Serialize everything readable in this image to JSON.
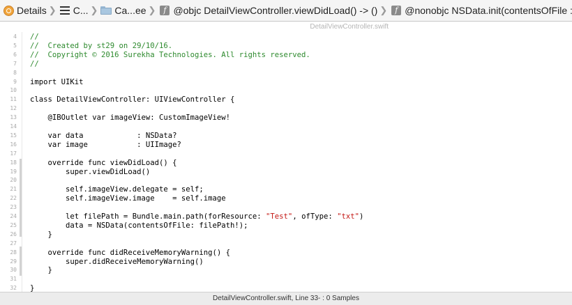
{
  "jumpbar": {
    "crumbs": [
      {
        "label": "Details",
        "icon": "project-icon"
      },
      {
        "label": "C...",
        "icon": "list-icon"
      },
      {
        "label": "Ca...ee",
        "icon": "folder-icon"
      },
      {
        "label": "@objc DetailViewController.viewDidLoad() -> ()",
        "icon": "function-icon"
      },
      {
        "label": "@nonobjc NSData.init(contentsOfFile : String) -> NSData?",
        "icon": "function-icon"
      }
    ]
  },
  "editor": {
    "file_title": "DetailViewController.swift",
    "lines": [
      {
        "n": "4",
        "segments": [
          {
            "t": "//",
            "c": "cm"
          }
        ]
      },
      {
        "n": "5",
        "segments": [
          {
            "t": "//  Created by st29 on 29/10/16.",
            "c": "cm"
          }
        ]
      },
      {
        "n": "6",
        "segments": [
          {
            "t": "//  Copyright © 2016 Surekha Technologies. All rights reserved.",
            "c": "cm"
          }
        ]
      },
      {
        "n": "7",
        "segments": [
          {
            "t": "//",
            "c": "cm"
          }
        ]
      },
      {
        "n": "8",
        "segments": []
      },
      {
        "n": "9",
        "segments": [
          {
            "t": "import UIKit",
            "c": ""
          }
        ]
      },
      {
        "n": "10",
        "segments": []
      },
      {
        "n": "11",
        "segments": [
          {
            "t": "class DetailViewController: UIViewController {",
            "c": ""
          }
        ]
      },
      {
        "n": "12",
        "segments": []
      },
      {
        "n": "13",
        "segments": [
          {
            "t": "    @IBOutlet var imageView: CustomImageView!",
            "c": ""
          }
        ]
      },
      {
        "n": "14",
        "segments": []
      },
      {
        "n": "15",
        "segments": [
          {
            "t": "    var data            : NSData?",
            "c": ""
          }
        ]
      },
      {
        "n": "16",
        "segments": [
          {
            "t": "    var image           : UIImage?",
            "c": ""
          }
        ]
      },
      {
        "n": "17",
        "segments": []
      },
      {
        "n": "18",
        "segments": [
          {
            "t": "    override func viewDidLoad() {",
            "c": ""
          }
        ]
      },
      {
        "n": "19",
        "segments": [
          {
            "t": "        super.viewDidLoad()",
            "c": ""
          }
        ]
      },
      {
        "n": "20",
        "segments": []
      },
      {
        "n": "21",
        "segments": [
          {
            "t": "        self.imageView.delegate = self;",
            "c": ""
          }
        ]
      },
      {
        "n": "22",
        "segments": [
          {
            "t": "        self.imageView.image    = self.image",
            "c": ""
          }
        ]
      },
      {
        "n": "23",
        "segments": []
      },
      {
        "n": "24",
        "segments": [
          {
            "t": "        let filePath = Bundle.main.path(forResource: ",
            "c": ""
          },
          {
            "t": "\"Test\"",
            "c": "st"
          },
          {
            "t": ", ofType: ",
            "c": ""
          },
          {
            "t": "\"txt\"",
            "c": "st"
          },
          {
            "t": ")",
            "c": ""
          }
        ]
      },
      {
        "n": "25",
        "segments": [
          {
            "t": "        data = NSData(contentsOfFile: filePath!);",
            "c": ""
          }
        ]
      },
      {
        "n": "26",
        "segments": [
          {
            "t": "    }",
            "c": ""
          }
        ]
      },
      {
        "n": "27",
        "segments": []
      },
      {
        "n": "28",
        "segments": [
          {
            "t": "    override func didReceiveMemoryWarning() {",
            "c": ""
          }
        ]
      },
      {
        "n": "29",
        "segments": [
          {
            "t": "        super.didReceiveMemoryWarning()",
            "c": ""
          }
        ]
      },
      {
        "n": "30",
        "segments": [
          {
            "t": "    }",
            "c": ""
          }
        ]
      },
      {
        "n": "31",
        "segments": []
      },
      {
        "n": "32",
        "segments": [
          {
            "t": "}",
            "c": ""
          }
        ]
      }
    ]
  },
  "status_bar": {
    "text": "DetailViewController.swift, Line 33- : 0 Samples"
  },
  "colors": {
    "comment": "#2e8a2e",
    "string": "#c41a16",
    "line_number": "#a8a8a8"
  }
}
